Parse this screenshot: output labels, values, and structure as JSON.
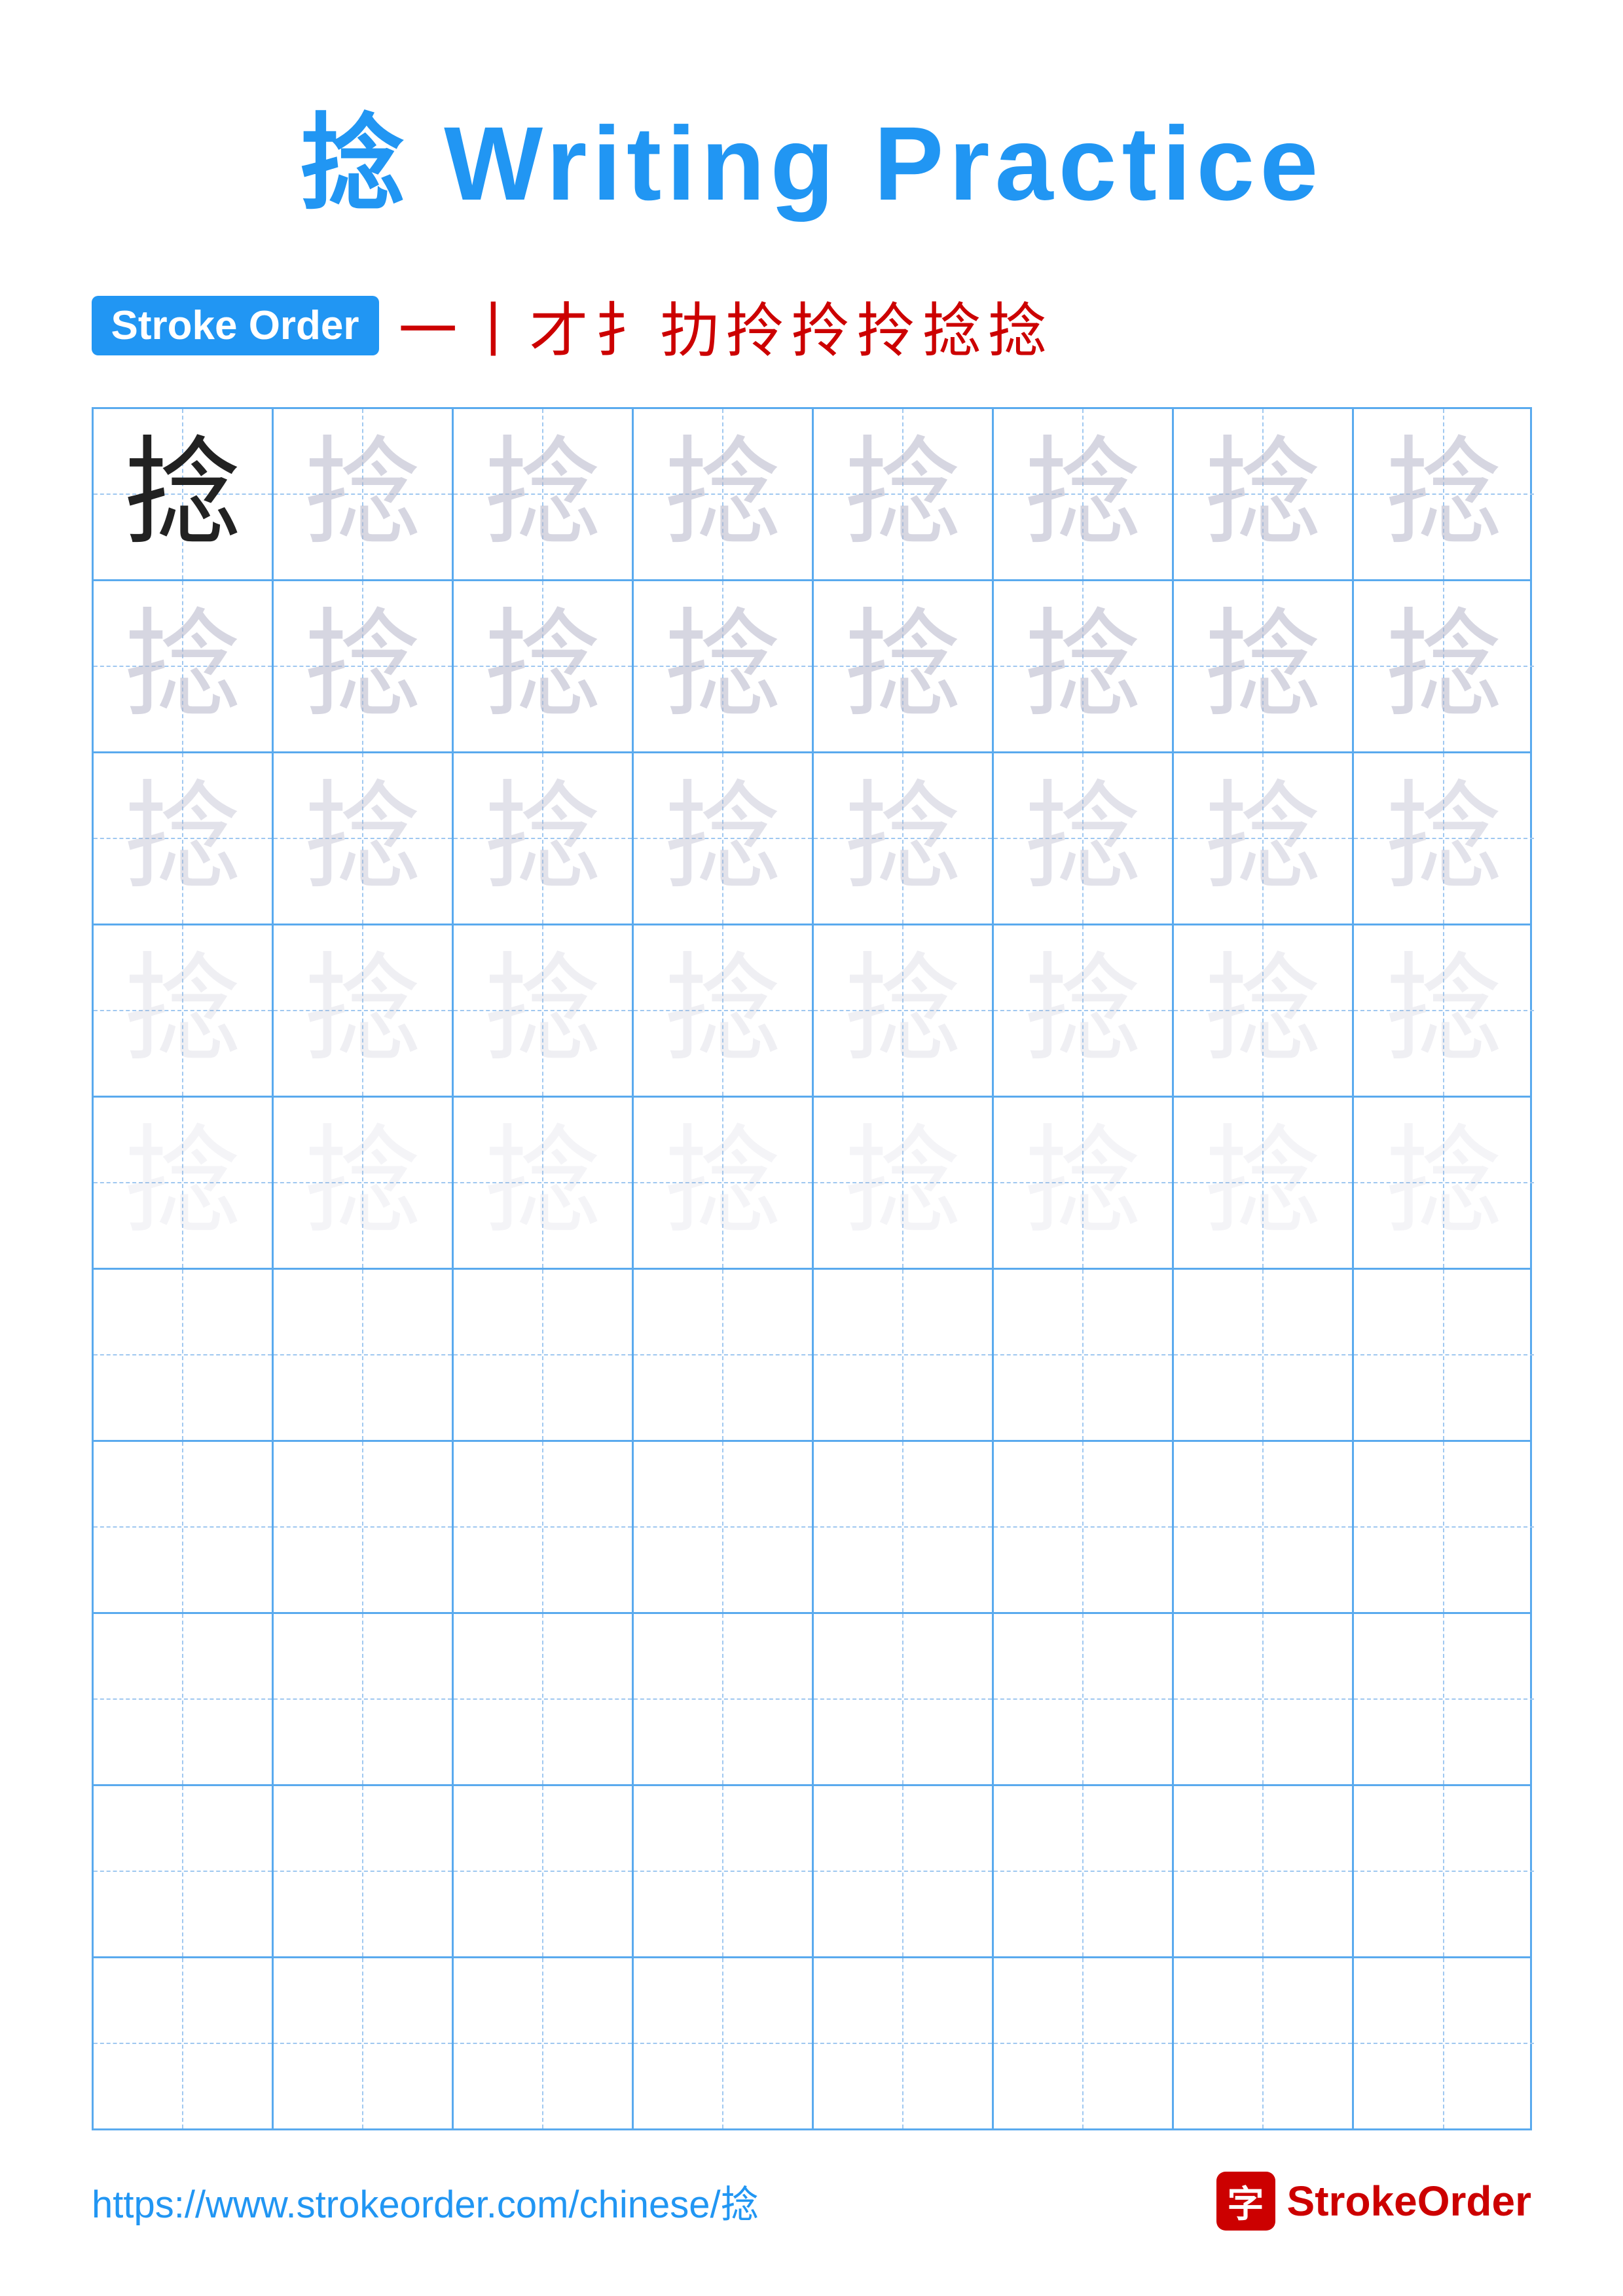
{
  "title": "捻 Writing Practice",
  "stroke_order_badge": "Stroke Order",
  "stroke_sequence": [
    "一",
    "丨",
    "才",
    "扌",
    "扐",
    "拎",
    "拎",
    "拎",
    "捻",
    "捻"
  ],
  "character": "捻",
  "grid": {
    "rows": 10,
    "cols": 8,
    "char_rows": [
      {
        "type": "dark",
        "count": 1,
        "light_count": 7
      },
      {
        "type": "light1",
        "count": 8
      },
      {
        "type": "light2",
        "count": 8
      },
      {
        "type": "light3",
        "count": 8
      },
      {
        "type": "light3_fade",
        "count": 8
      },
      {
        "type": "empty",
        "count": 8
      },
      {
        "type": "empty",
        "count": 8
      },
      {
        "type": "empty",
        "count": 8
      },
      {
        "type": "empty",
        "count": 8
      },
      {
        "type": "empty",
        "count": 8
      }
    ]
  },
  "footer": {
    "url": "https://www.strokeorder.com/chinese/捻",
    "logo_char": "字",
    "logo_text": "StrokeOrder"
  }
}
